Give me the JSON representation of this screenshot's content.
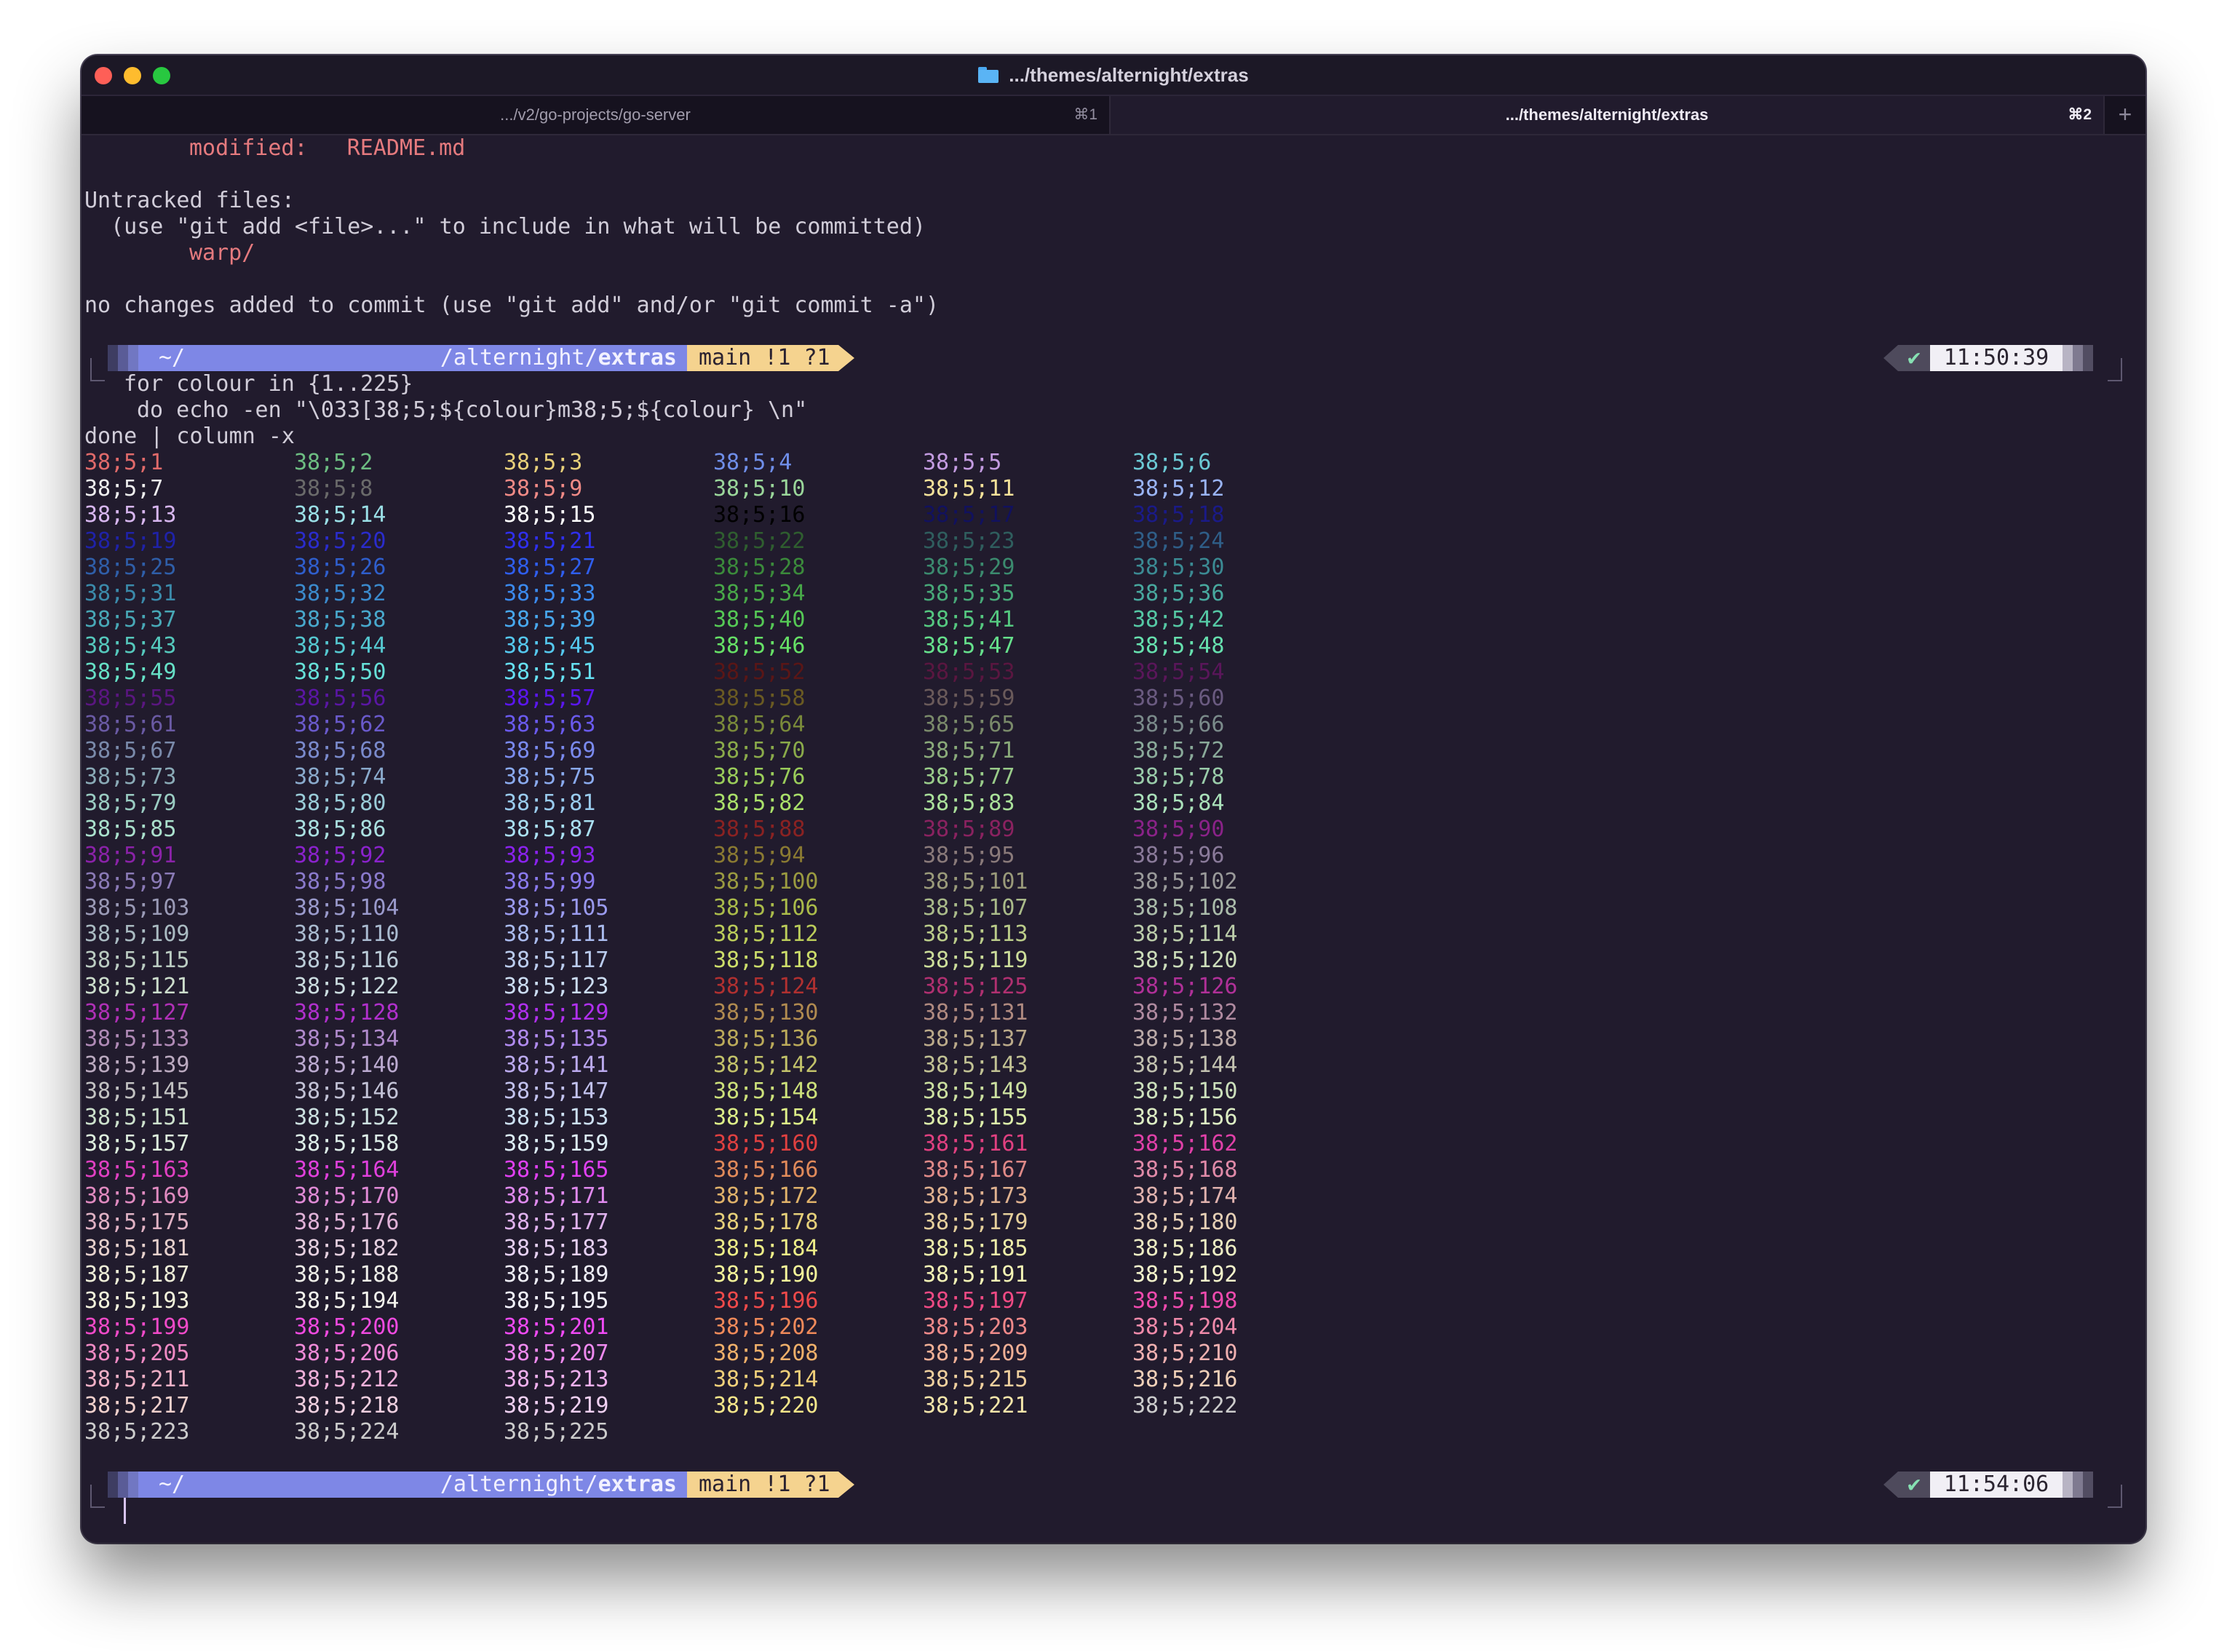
{
  "window": {
    "title": ".../themes/alternight/extras",
    "folder_icon": "folder-icon"
  },
  "tabs": [
    {
      "label": ".../v2/go-projects/go-server",
      "shortcut": "⌘1",
      "active": false
    },
    {
      "label": ".../themes/alternight/extras",
      "shortcut": "⌘2",
      "active": true
    }
  ],
  "new_tab_label": "+",
  "output": {
    "modified_label": "modified:",
    "modified_file": "README.md",
    "untracked_header": "Untracked files:",
    "untracked_hint": "  (use \"git add <file>...\" to include in what will be committed)",
    "untracked_file": "warp/",
    "no_changes": "no changes added to commit (use \"git add\" and/or \"git commit -a\")"
  },
  "prompts": [
    {
      "home": "~/",
      "path_prefix": "/alternight/",
      "path_bold": "extras",
      "git": "main !1 ?1",
      "status_icon": "✔",
      "time": "11:50:39"
    },
    {
      "home": "~/",
      "path_prefix": "/alternight/",
      "path_bold": "extras",
      "git": "main !1 ?1",
      "status_icon": "✔",
      "time": "11:54:06"
    }
  ],
  "command": {
    "line1": "for colour in {1..225}",
    "line2": "do echo -en \"\\033[38;5;${colour}m38;5;${colour} \\n\"",
    "line3": "done | column -x"
  },
  "colour_table": {
    "prefix": "38;5;",
    "count": 225,
    "columns": 6,
    "colours": [
      "#e06a6a",
      "#6dbd82",
      "#e8d07a",
      "#6f8ee8",
      "#c39be0",
      "#6bc9d4",
      "#eeeeee",
      "#6a6a6a",
      "#f08a86",
      "#9ad69a",
      "#f5e29a",
      "#9ab4f5",
      "#d7b6ef",
      "#9adfe6",
      "#ffffff",
      "#000000",
      "#11115e",
      "#1a1a88",
      "#1f22a8",
      "#2a2ccc",
      "#2f2fee",
      "#2f5e2f",
      "#2f5e5e",
      "#2f5e88",
      "#2f5ea8",
      "#2f5ecc",
      "#2f5eee",
      "#3b8a3b",
      "#3b8a6e",
      "#3b8a93",
      "#3b8aaa",
      "#3b8acc",
      "#3b8aee",
      "#48a848",
      "#48a878",
      "#48a89e",
      "#48a8b6",
      "#48a8cc",
      "#48a8ee",
      "#55c855",
      "#55c880",
      "#55c8a4",
      "#55c8bc",
      "#55c8d0",
      "#55c8ee",
      "#66e066",
      "#66e08c",
      "#66e0ae",
      "#66e0c6",
      "#66e0d8",
      "#66e0f2",
      "#5a1616",
      "#5a1640",
      "#5a165a",
      "#5a1680",
      "#5a16a4",
      "#5a16ee",
      "#6a5a22",
      "#6a5a5a",
      "#6a5a80",
      "#6a5aa4",
      "#6a5acc",
      "#6a5aee",
      "#7a8a3a",
      "#7a8a6a",
      "#7a8a8a",
      "#7a8aaa",
      "#7a8acc",
      "#7a8aee",
      "#8aaa4a",
      "#8aaa7a",
      "#8aaa9a",
      "#8aaab6",
      "#8aaacc",
      "#8aaaee",
      "#9acc5a",
      "#9acc8a",
      "#9accaa",
      "#9accc2",
      "#9accd8",
      "#9accee",
      "#aae06a",
      "#aae09a",
      "#aae0ba",
      "#aae0cc",
      "#aae0e0",
      "#aae0f2",
      "#8a2222",
      "#8a2260",
      "#8a2288",
      "#8a22a8",
      "#8a22cc",
      "#8a22ee",
      "#8a7a32",
      "#8a7a7a",
      "#8a7a9a",
      "#8a7ab6",
      "#8a7acc",
      "#8a7aee",
      "#9a9a40",
      "#9a9a7a",
      "#9a9a9a",
      "#9a9ab6",
      "#9a9acc",
      "#9a9aee",
      "#aabb4a",
      "#aabb8a",
      "#aabbaa",
      "#aabbc2",
      "#aabbd0",
      "#aabbee",
      "#bbcc5a",
      "#bbcc8a",
      "#bbccaa",
      "#bbccc2",
      "#bbccd8",
      "#bbccee",
      "#ccdd6a",
      "#ccdd9a",
      "#ccddba",
      "#ccddcc",
      "#ccdde0",
      "#ccddf2",
      "#b03030",
      "#b03070",
      "#b03098",
      "#b030b6",
      "#b030cc",
      "#b030ee",
      "#b08a50",
      "#b08a80",
      "#b08aa0",
      "#b08ab6",
      "#b08acc",
      "#b08aee",
      "#bbaa5a",
      "#bbaa8a",
      "#bbaaa8",
      "#bbaac0",
      "#bbaad0",
      "#bbaaee",
      "#c2c26a",
      "#c2c294",
      "#c2c2b0",
      "#c2c2c2",
      "#c2c2d6",
      "#c2c2ee",
      "#cce07a",
      "#cce0a0",
      "#cce0bc",
      "#cce0cc",
      "#cce0e0",
      "#cce0f2",
      "#ddee88",
      "#ddeeaa",
      "#ddeec4",
      "#ddeedd",
      "#ddeee8",
      "#ddeef6",
      "#e04040",
      "#e04080",
      "#e040a8",
      "#e040c2",
      "#e040dc",
      "#e040f2",
      "#e08a5a",
      "#e08a88",
      "#e08aa8",
      "#e08ac0",
      "#e08ad6",
      "#e08aee",
      "#e0b26a",
      "#e0b290",
      "#e0b2ae",
      "#e0b2c4",
      "#e0b2d8",
      "#e0b2ee",
      "#e6d07a",
      "#e6d09c",
      "#e6d0b6",
      "#e6d0cc",
      "#e6d0e0",
      "#e6d0f2",
      "#eeee88",
      "#eeeeaa",
      "#eeeec4",
      "#eeeed8",
      "#eeeee8",
      "#eeeef6",
      "#f5f59a",
      "#f5f5b6",
      "#f5f5cc",
      "#f5f5dd",
      "#f5f5ee",
      "#f5f5ff",
      "#f04a4a",
      "#f04a84",
      "#f04aae",
      "#f04ac8",
      "#f04ae0",
      "#f04af5",
      "#f08a5a",
      "#f08a8a",
      "#f08aaa",
      "#f08ac4",
      "#f08ad8",
      "#f08af0",
      "#f0b06a",
      "#f0b096",
      "#f0b0b0",
      "#f0b0c6",
      "#f0b0da",
      "#f0b0ee",
      "#f0d07a",
      "#f0d09e",
      "#f0d0b8",
      "#f0d0cc",
      "#f0d0e0",
      "#f0d0f2",
      "#f5e68a",
      "#f5e6aa"
    ]
  }
}
